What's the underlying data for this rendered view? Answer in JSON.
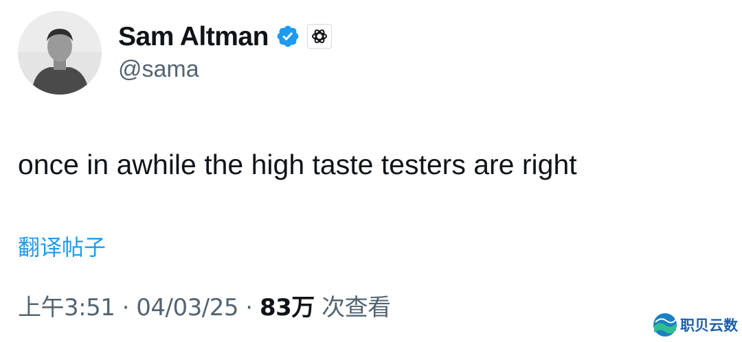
{
  "author": {
    "display_name": "Sam Altman",
    "handle": "@sama",
    "verified_icon": "verified-badge-icon",
    "affiliate_icon": "openai-logo-icon"
  },
  "tweet": {
    "text": "once in awhile the high taste testers are right",
    "translate_label": "翻译帖子"
  },
  "meta": {
    "time": "上午3:51",
    "separator": " · ",
    "date": "04/03/25",
    "views_count": "83万",
    "views_label": " 次查看"
  },
  "watermark": {
    "text": "职贝云数"
  },
  "colors": {
    "accent": "#1d9bf0",
    "secondary_text": "#536471",
    "primary_text": "#0f1419"
  }
}
